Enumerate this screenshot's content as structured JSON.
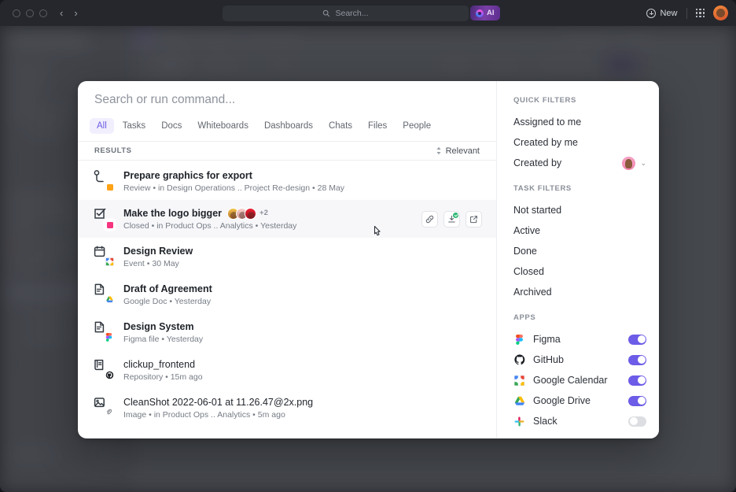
{
  "window": {
    "traffic_lights": [
      "close",
      "minimize",
      "maximize"
    ],
    "nav_back": "‹",
    "nav_forward": "›",
    "search_placeholder": "Search...",
    "ai_label": "AI",
    "new_label": "New"
  },
  "palette": {
    "search": {
      "value": "",
      "placeholder": "Search or run command..."
    },
    "tabs": [
      {
        "label": "All",
        "active": true
      },
      {
        "label": "Tasks",
        "active": false
      },
      {
        "label": "Docs",
        "active": false
      },
      {
        "label": "Whiteboards",
        "active": false
      },
      {
        "label": "Dashboards",
        "active": false
      },
      {
        "label": "Chats",
        "active": false
      },
      {
        "label": "Files",
        "active": false
      },
      {
        "label": "People",
        "active": false
      }
    ],
    "results_label": "RESULTS",
    "sort_label": "Relevant",
    "results": [
      {
        "title": "Prepare graphics for export",
        "meta": "Review  •  in Design Operations ..  Project Re-design  •  28 May",
        "icon": "subtask-icon",
        "badge_color": "#ffa216",
        "hovered": false
      },
      {
        "title": "Make the logo bigger",
        "meta": "Closed  •  in Product Ops ..  Analytics  •  Yesterday",
        "icon": "task-checkbox-icon",
        "badge_color": "#f5357f",
        "hovered": true,
        "avatars_overflow": "+2",
        "actions": [
          "link-icon",
          "install-icon",
          "open-external-icon"
        ]
      },
      {
        "title": "Design Review",
        "meta": "Event  •  30 May",
        "icon": "calendar-icon",
        "hovered": false
      },
      {
        "title": "Draft of Agreement",
        "meta": "Google Doc  •  Yesterday",
        "icon": "document-icon",
        "hovered": false
      },
      {
        "title": "Design System",
        "meta": "Figma file  •  Yesterday",
        "icon": "document-icon",
        "hovered": false
      },
      {
        "title": "clickup_frontend",
        "meta": "Repository  •  15m ago",
        "icon": "repository-icon",
        "hovered": false
      },
      {
        "title": "CleanShot 2022-06-01 at 11.26.47@2x.png",
        "meta": "Image  •  in Product Ops ..  Analytics  •  5m ago",
        "icon": "image-icon",
        "hovered": false
      }
    ]
  },
  "sidebar": {
    "quick_filters_title": "QUICK FILTERS",
    "quick_filters": [
      {
        "label": "Assigned to me"
      },
      {
        "label": "Created by me"
      },
      {
        "label": "Created by",
        "has_avatar": true,
        "chevron": "⌄"
      }
    ],
    "task_filters_title": "TASK FILTERS",
    "task_filters": [
      {
        "label": "Not started"
      },
      {
        "label": "Active"
      },
      {
        "label": "Done"
      },
      {
        "label": "Closed"
      },
      {
        "label": "Archived"
      }
    ],
    "apps_title": "APPS",
    "apps": [
      {
        "label": "Figma",
        "icon": "figma-icon",
        "enabled": true
      },
      {
        "label": "GitHub",
        "icon": "github-icon",
        "enabled": true
      },
      {
        "label": "Google Calendar",
        "icon": "google-calendar-icon",
        "enabled": true
      },
      {
        "label": "Google Drive",
        "icon": "google-drive-icon",
        "enabled": true
      },
      {
        "label": "Slack",
        "icon": "slack-icon",
        "enabled": false
      }
    ]
  },
  "colors": {
    "accent": "#6c5ce7",
    "tab_active_bg": "#f1effd",
    "overlay": "#555a63",
    "toggle_on": "#6c5ce7",
    "toggle_off": "#dcdee2"
  }
}
